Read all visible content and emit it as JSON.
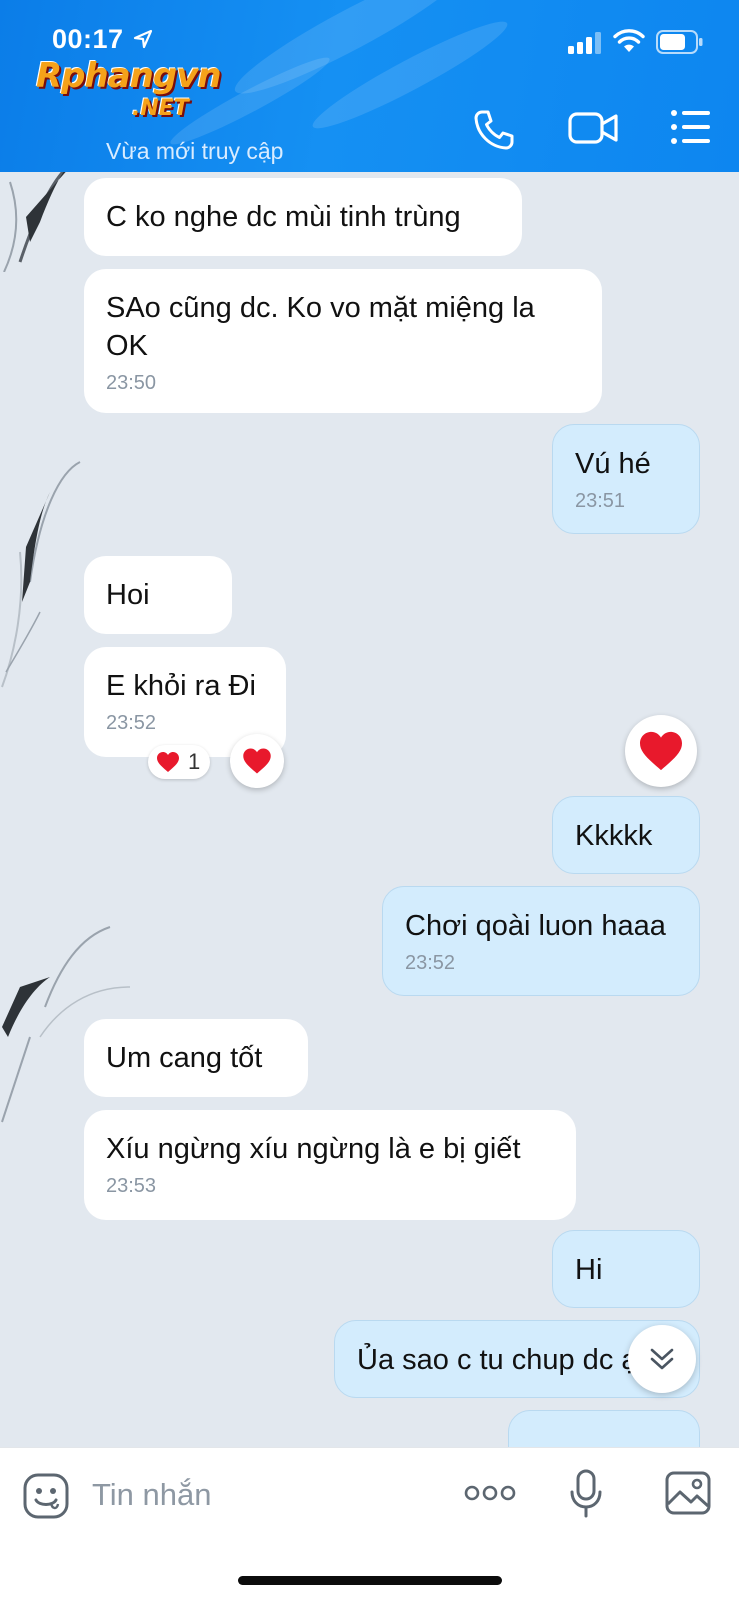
{
  "status_bar": {
    "time": "00:17"
  },
  "header": {
    "watermark_top": "Rphangvn",
    "watermark_bottom": ".NET",
    "last_seen": "Vừa mới truy cập"
  },
  "messages": [
    {
      "side": "in",
      "text": "C ko nghe dc mùi tinh trùng",
      "time": ""
    },
    {
      "side": "in",
      "text": "SAo cũng dc.  Ko vo mặt miệng la OK",
      "time": "23:50"
    },
    {
      "side": "out",
      "text": "Vú hé",
      "time": "23:51"
    },
    {
      "side": "in",
      "text": "Hoi",
      "time": ""
    },
    {
      "side": "in",
      "text": "E khỏi ra Đi",
      "time": "23:52",
      "reaction_count": "1"
    },
    {
      "side": "out",
      "text": "Kkkkk",
      "time": ""
    },
    {
      "side": "out",
      "text": "Chơi qoài luon haaa",
      "time": "23:52"
    },
    {
      "side": "in",
      "text": "Um cang tốt",
      "time": ""
    },
    {
      "side": "in",
      "text": "Xíu ngừng xíu ngừng là e bị giết",
      "time": "23:53"
    },
    {
      "side": "out",
      "text": "Hi",
      "time": ""
    },
    {
      "side": "out",
      "text": "Ủa sao c tu chup dc ạ",
      "time": ""
    }
  ],
  "input_bar": {
    "placeholder": "Tin nhắn"
  },
  "colors": {
    "header_blue": "#0d86f0",
    "chat_background": "#e2e8ef",
    "outgoing_bubble": "#d3ecfd",
    "incoming_bubble": "#ffffff",
    "heart_red": "#e8192c"
  },
  "icons": {
    "call": "phone-icon",
    "video": "video-camera-icon",
    "menu": "list-menu-icon",
    "emoji": "smiley-icon",
    "more": "three-dots-icon",
    "mic": "microphone-icon",
    "image": "image-icon",
    "reaction": "heart-icon",
    "scroll": "double-chevron-down-icon"
  }
}
